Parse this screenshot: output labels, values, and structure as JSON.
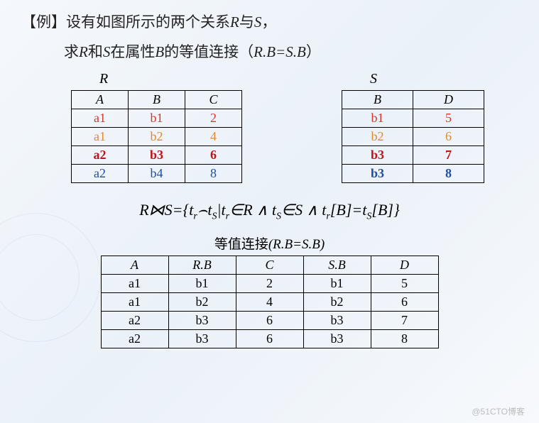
{
  "title_prefix": "【例】",
  "title_main": "设有如图所示的两个关系",
  "title_r": "R",
  "title_and": "与",
  "title_s": "S",
  "title_comma": "，",
  "line2_a": "求",
  "line2_b": "和",
  "line2_c": "在属性",
  "line2_attr": "B",
  "line2_d": "的等值连接（",
  "line2_cond": "R.B=S.B",
  "line2_e": "）",
  "label_r": "R",
  "label_s": "S",
  "r_headers": [
    "A",
    "B",
    "C"
  ],
  "r_rows": [
    {
      "a": "a1",
      "b": "b1",
      "c": "2",
      "cls": "c-red"
    },
    {
      "a": "a1",
      "b": "b2",
      "c": "4",
      "cls": "c-orange"
    },
    {
      "a": "a2",
      "b": "b3",
      "c": "6",
      "cls": "c-darkred"
    },
    {
      "a": "a2",
      "b": "b4",
      "c": "8",
      "cls": "c-blue"
    }
  ],
  "s_headers": [
    "B",
    "D"
  ],
  "s_rows": [
    {
      "b": "b1",
      "d": "5",
      "cls": "c-red"
    },
    {
      "b": "b2",
      "d": "6",
      "cls": "c-orange"
    },
    {
      "b": "b3",
      "d": "7",
      "cls": "c-darkred"
    },
    {
      "b": "b3",
      "d": "8",
      "cls": "c-blue-bold"
    }
  ],
  "formula_parts": {
    "lhs": "R⋈S=",
    "brace_l": "{",
    "tr": "t",
    "r_sub": "r",
    "frown": "⌢",
    "ts": "t",
    "s_sub": "S",
    "bar": "|",
    "in": "∈",
    "R": "R",
    "and": " ∧ ",
    "S": "S",
    "lb": "[",
    "B": "B",
    "rb": "]",
    "eq": "=",
    "brace_r": "}"
  },
  "join_title_cn": "等值连接",
  "join_title_cond": "(R.B=S.B)",
  "join_headers": [
    "A",
    "R.B",
    "C",
    "S.B",
    "D"
  ],
  "join_rows": [
    [
      "a1",
      "b1",
      "2",
      "b1",
      "5"
    ],
    [
      "a1",
      "b2",
      "4",
      "b2",
      "6"
    ],
    [
      "a2",
      "b3",
      "6",
      "b3",
      "7"
    ],
    [
      "a2",
      "b3",
      "6",
      "b3",
      "8"
    ]
  ],
  "watermark": "@51CTO博客",
  "chart_data": {
    "type": "table",
    "relations": {
      "R": {
        "columns": [
          "A",
          "B",
          "C"
        ],
        "rows": [
          [
            "a1",
            "b1",
            2
          ],
          [
            "a1",
            "b2",
            4
          ],
          [
            "a2",
            "b3",
            6
          ],
          [
            "a2",
            "b4",
            8
          ]
        ]
      },
      "S": {
        "columns": [
          "B",
          "D"
        ],
        "rows": [
          [
            "b1",
            5
          ],
          [
            "b2",
            6
          ],
          [
            "b3",
            7
          ],
          [
            "b3",
            8
          ]
        ]
      }
    },
    "equijoin": {
      "condition": "R.B=S.B",
      "columns": [
        "A",
        "R.B",
        "C",
        "S.B",
        "D"
      ],
      "rows": [
        [
          "a1",
          "b1",
          2,
          "b1",
          5
        ],
        [
          "a1",
          "b2",
          4,
          "b2",
          6
        ],
        [
          "a2",
          "b3",
          6,
          "b3",
          7
        ],
        [
          "a2",
          "b3",
          6,
          "b3",
          8
        ]
      ]
    }
  }
}
